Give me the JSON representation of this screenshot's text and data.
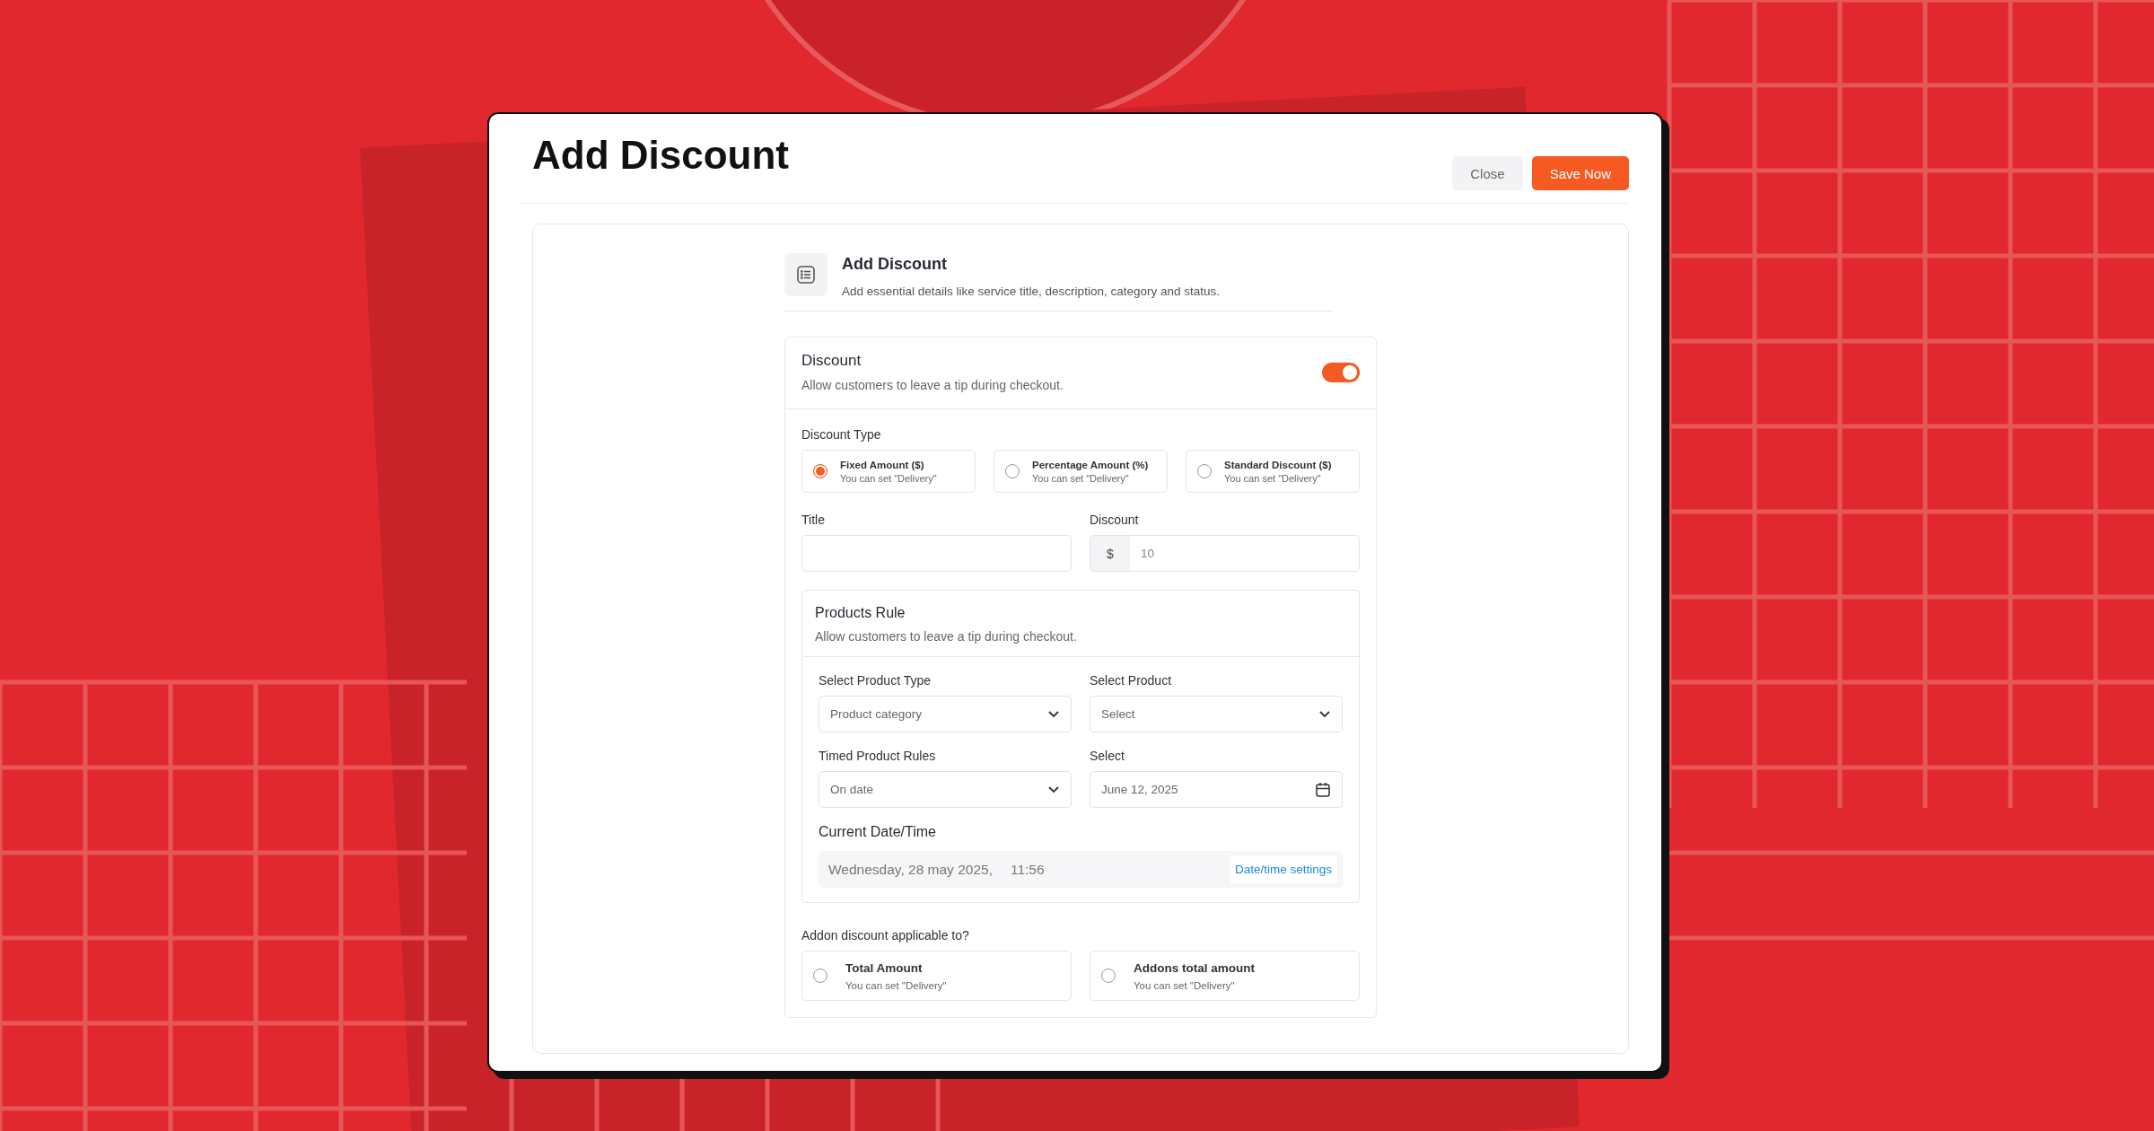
{
  "header": {
    "title": "Add Discount",
    "buttons": [
      {
        "label": "Close",
        "kind": "secondary"
      },
      {
        "label": "Save Now",
        "kind": "primary"
      }
    ]
  },
  "section": {
    "title": "Add Discount",
    "description": "Add essential details like service title, description, category and status."
  },
  "discount": {
    "title": "Discount",
    "description": "Allow customers to leave a tip during checkout.",
    "on": true
  },
  "discount_type": {
    "label": "Discount Type",
    "options": [
      {
        "title": "Fixed Amount ($)",
        "subtitle": "You can set \"Delivery\"",
        "selected": true
      },
      {
        "title": "Percentage Amount (%)",
        "subtitle": "You can set \"Delivery\"",
        "selected": false
      },
      {
        "title": "Standard Discount ($)",
        "subtitle": "You can set \"Delivery\"",
        "selected": false
      }
    ]
  },
  "title_field": {
    "label": "Title"
  },
  "discount_field": {
    "label": "Discount",
    "prefix": "$",
    "placeholder": "10"
  },
  "products_rule": {
    "title": "Products Rule",
    "description": "Allow customers to leave a tip during checkout.",
    "fields": [
      {
        "label": "Select Product Type",
        "kind": "select",
        "value": "Product category"
      },
      {
        "label": "Select Product",
        "kind": "select",
        "value": "Select"
      },
      {
        "label": "Timed Product Rules",
        "kind": "select",
        "value": "On date"
      },
      {
        "label": "Select",
        "kind": "date",
        "value": "June 12, 2025"
      }
    ]
  },
  "current_datetime": {
    "label": "Current Date/Time",
    "date": "Wednesday, 28 may 2025,",
    "time": "11:56",
    "link": "Date/time settings"
  },
  "addon": {
    "label": "Addon discount applicable to?",
    "options": [
      {
        "title": "Total Amount",
        "subtitle": "You can set \"Delivery\"",
        "selected": false
      },
      {
        "title": "Addons total amount",
        "subtitle": "You can set \"Delivery\"",
        "selected": false
      }
    ]
  }
}
